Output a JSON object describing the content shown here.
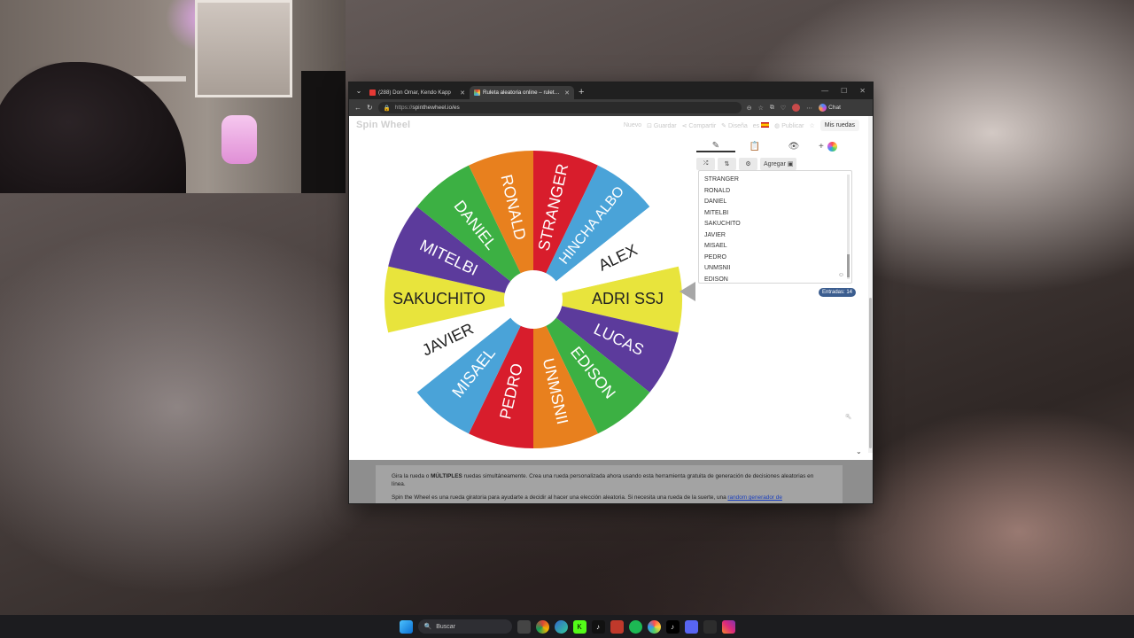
{
  "browser": {
    "tabs": [
      {
        "title": "(288) Don Omar, Kendo Kapp",
        "active": false,
        "favicon_color": "#e53935"
      },
      {
        "title": "Ruleta aleatoria online – ruleta de",
        "active": true,
        "favicon_color": "#42a5f5"
      }
    ],
    "url_scheme": "https://",
    "url_rest": "spinthewheel.io/es",
    "chat_label": "Chat"
  },
  "site": {
    "logo": "Spin Wheel",
    "nav": {
      "nuevo": "Nuevo",
      "guardar": "Guardar",
      "compartir": "Compartir",
      "disenar": "Diseña",
      "idioma": "es",
      "publicar": "Publicar",
      "mis_ruedas": "Mis ruedas"
    }
  },
  "editor": {
    "add_label": "Agregar",
    "entries": [
      "STRANGER",
      "RONALD",
      "DANIEL",
      "MITELBI",
      "SAKUCHITO",
      "JAVIER",
      "MISAEL",
      "PEDRO",
      "UNMSNII",
      "EDISON"
    ],
    "count_label": "Entradas: 14"
  },
  "wheel": {
    "segments": [
      {
        "label": "ADRI SSJ",
        "color": "#e8e43c",
        "text_color": "#222222"
      },
      {
        "label": "LUCAS",
        "color": "#5c3b9c",
        "text_color": "#ffffff"
      },
      {
        "label": "EDISON",
        "color": "#3cb043",
        "text_color": "#ffffff"
      },
      {
        "label": "UNMSNII",
        "color": "#e8801e",
        "text_color": "#ffffff"
      },
      {
        "label": "PEDRO",
        "color": "#d81d2c",
        "text_color": "#ffffff"
      },
      {
        "label": "MISAEL",
        "color": "#4aa3d8",
        "text_color": "#ffffff"
      },
      {
        "label": "JAVIER",
        "color": "#ffffff",
        "text_color": "#222222"
      },
      {
        "label": "SAKUCHITO",
        "color": "#e8e43c",
        "text_color": "#222222"
      },
      {
        "label": "MITELBI",
        "color": "#5c3b9c",
        "text_color": "#ffffff"
      },
      {
        "label": "DANIEL",
        "color": "#3cb043",
        "text_color": "#ffffff"
      },
      {
        "label": "RONALD",
        "color": "#e8801e",
        "text_color": "#ffffff"
      },
      {
        "label": "STRANGER",
        "color": "#d81d2c",
        "text_color": "#ffffff"
      },
      {
        "label": "HINCHA ALBO",
        "color": "#4aa3d8",
        "text_color": "#ffffff"
      },
      {
        "label": "ALEX",
        "color": "#ffffff",
        "text_color": "#222222"
      }
    ]
  },
  "description": {
    "p1_prefix": "Gira la rueda o ",
    "p1_bold": "MÚLTIPLES",
    "p1_suffix": " ruedas simultáneamente. Crea una rueda personalizada ahora usando esta herramienta gratuita de generación de decisiones aleatorias en línea.",
    "p2_prefix": "Spin the Wheel es una rueda giratoria para ayudarte a decidir al hacer una elección aleatoria. Si necesita una rueda de la suerte, una ",
    "p2_link": "random generador de"
  },
  "taskbar": {
    "search_placeholder": "Buscar"
  }
}
